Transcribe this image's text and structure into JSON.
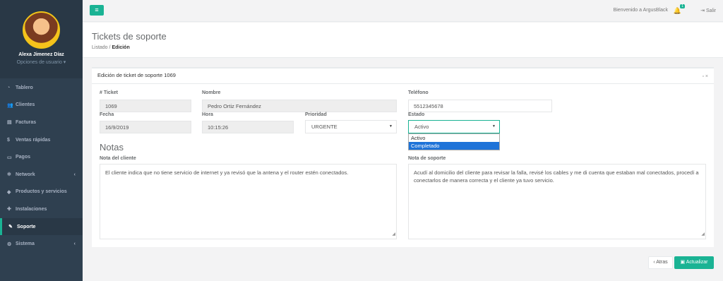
{
  "user": {
    "name": "Alexa Jimenez Díaz",
    "options": "Opciones de usuario ▾"
  },
  "nav": [
    {
      "icon": "tachometer-icon",
      "glyph": "◔",
      "label": "Tablero"
    },
    {
      "icon": "users-icon",
      "glyph": "👥",
      "label": "Clientes"
    },
    {
      "icon": "file-icon",
      "glyph": "▤",
      "label": "Facturas"
    },
    {
      "icon": "dollar-icon",
      "glyph": "$",
      "label": "Ventas rápidas"
    },
    {
      "icon": "money-icon",
      "glyph": "▭",
      "label": "Pagos"
    },
    {
      "icon": "network-icon",
      "glyph": "✲",
      "label": "Network",
      "chev": "‹"
    },
    {
      "icon": "tags-icon",
      "glyph": "◆",
      "label": "Productos y servicios"
    },
    {
      "icon": "wrench-icon",
      "glyph": "✚",
      "label": "Instalaciones"
    },
    {
      "icon": "wrench-icon",
      "glyph": "✎",
      "label": "Soporte",
      "active": true
    },
    {
      "icon": "cogs-icon",
      "glyph": "⚙",
      "label": "Sistema",
      "chev": "‹"
    }
  ],
  "topbar": {
    "menu_glyph": "≡",
    "welcome": "Bienvenido a ArgusBlack",
    "notif_count": "1",
    "logout": "⇥ Salir"
  },
  "page": {
    "title": "Tickets de soporte",
    "bc_list": "Listado",
    "bc_sep": "/",
    "bc_current": "Edición"
  },
  "panel": {
    "title": "Edición de ticket de soporte 1069",
    "tools": "▫ ×"
  },
  "form": {
    "ticket_label": "# Ticket",
    "ticket": "1069",
    "name_label": "Nombre",
    "name": "Pedro Ortiz Fernández",
    "phone_label": "Teléfono",
    "phone": "5512345678",
    "date_label": "Fecha",
    "date": "16/9/2019",
    "time_label": "Hora",
    "time": "10:15:26",
    "priority_label": "Prioridad",
    "priority": "URGENTE",
    "status_label": "Estado",
    "status": "Activo",
    "status_options": [
      "Activo",
      "Completado"
    ],
    "notes_heading": "Notas",
    "client_note_label": "Nota del cliente",
    "client_note": "El cliente indica que no tiene servicio de internet y ya revisó que la antena y el router estén conectados.",
    "support_note_label": "Nota de soporte",
    "support_note": "Acudí al domicilio del cliente para revisar la falla, revisé los cables y me di cuenta que estaban mal conectados, procedí a conectarlos de manera correcta y el cliente ya tuvo servicio."
  },
  "buttons": {
    "back": "‹ Atras",
    "update": "▣ Actualizar"
  },
  "colors": {
    "accent": "#1ab394",
    "sidebar": "#2f4050"
  }
}
